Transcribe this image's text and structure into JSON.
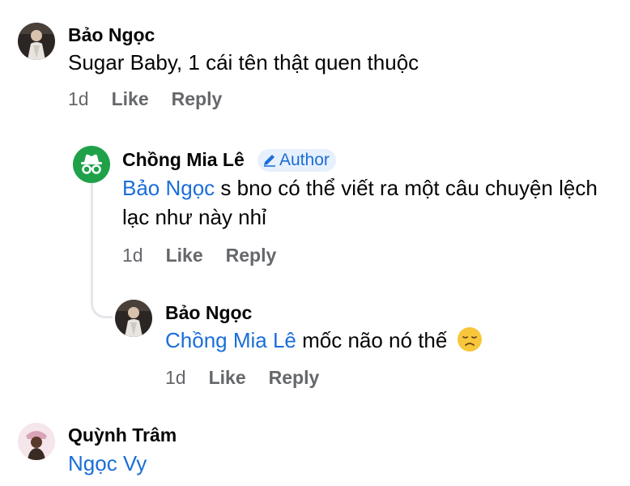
{
  "comments": [
    {
      "author": "Bảo Ngọc",
      "text": "Sugar Baby, 1 cái tên thật quen thuộc",
      "time": "1d",
      "like": "Like",
      "reply": "Reply"
    },
    {
      "author": "Chồng Mia Lê",
      "badge": "Author",
      "mention": "Bảo Ngọc",
      "text": " s bno có thể viết ra một câu chuyện lệch lạc như này nhỉ",
      "time": "1d",
      "like": "Like",
      "reply": "Reply"
    },
    {
      "author": "Bảo Ngọc",
      "mention": "Chồng Mia Lê",
      "text": " mốc não nó thế",
      "emoji": "😞",
      "time": "1d",
      "like": "Like",
      "reply": "Reply"
    },
    {
      "author": "Quỳnh Trâm",
      "mention": "Ngọc Vy"
    }
  ],
  "colors": {
    "mention": "#1a6ed8",
    "meta": "#65676b",
    "author_avatar_bg": "#1fa14a",
    "badge_bg": "#e7f0fd"
  },
  "icons": {
    "author_avatar": "incognito-icon",
    "badge": "pencil-icon",
    "sad_emoji": "disappointed-face-icon"
  }
}
